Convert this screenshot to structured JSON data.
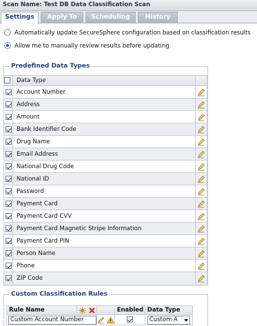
{
  "header": {
    "title": "Scan Name: Test DB Data Classification Scan"
  },
  "tabs": [
    {
      "label": "Settings",
      "active": true
    },
    {
      "label": "Apply To",
      "active": false
    },
    {
      "label": "Scheduling",
      "active": false
    },
    {
      "label": "History",
      "active": false
    }
  ],
  "options": {
    "auto_update": {
      "label": "Automatically update SecureSphere configuration based on classification results",
      "selected": false
    },
    "manual_review": {
      "label": "Allow me to manually review results before updating",
      "selected": true
    }
  },
  "predefined": {
    "title": "Predefined Data Types",
    "column_header": "Data Type",
    "rows": [
      {
        "name": "Account Number",
        "checked": true
      },
      {
        "name": "Address",
        "checked": true
      },
      {
        "name": "Amount",
        "checked": true
      },
      {
        "name": "Bank Identifier Code",
        "checked": true
      },
      {
        "name": "Drug Name",
        "checked": true
      },
      {
        "name": "Email Address",
        "checked": true
      },
      {
        "name": "National Drug Code",
        "checked": true
      },
      {
        "name": "National ID",
        "checked": true
      },
      {
        "name": "Password",
        "checked": true
      },
      {
        "name": "Payment Card",
        "checked": true
      },
      {
        "name": "Payment Card CVV",
        "checked": true
      },
      {
        "name": "Payment Card Magnetic Stripe Information",
        "checked": true
      },
      {
        "name": "Payment Card PIN",
        "checked": true
      },
      {
        "name": "Person Name",
        "checked": true
      },
      {
        "name": "Phone",
        "checked": true
      },
      {
        "name": "ZIP Code",
        "checked": true
      }
    ]
  },
  "custom": {
    "title": "Custom Classification Rules",
    "headers": {
      "rule_name": "Rule Name",
      "enabled": "Enabled",
      "data_type": "Data Type"
    },
    "rows": [
      {
        "rule_name": "Custom Account Number",
        "enabled": true,
        "data_type": "Custom A"
      }
    ]
  },
  "colors": {
    "accent": "#23407a",
    "tab_inactive": "#aeb5bf",
    "row_alt": "#eceef1"
  }
}
